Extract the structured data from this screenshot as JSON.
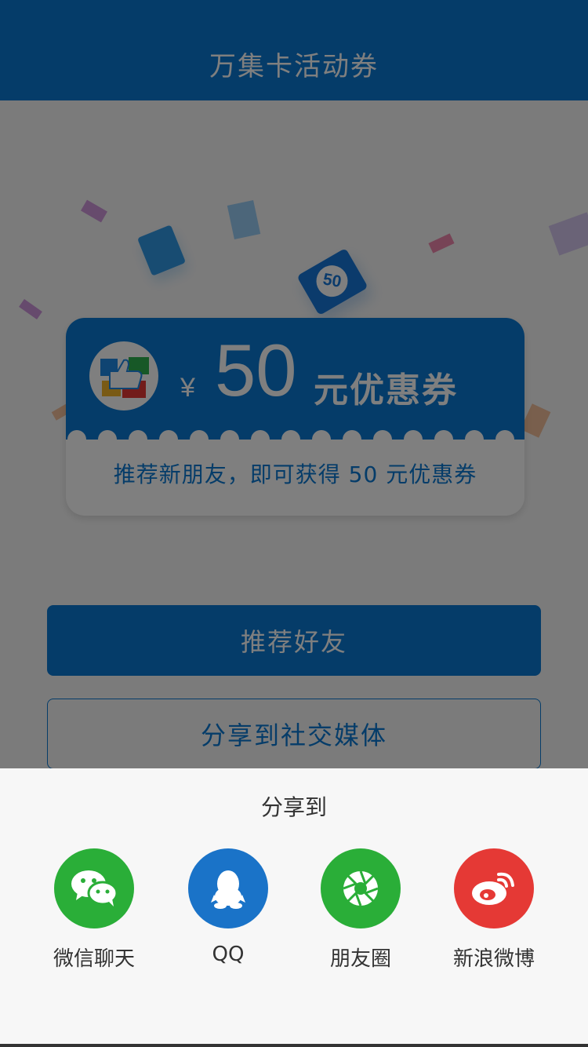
{
  "header": {
    "title": "万集卡活动券"
  },
  "coupon": {
    "badge_number": "50",
    "currency": "¥",
    "amount": "50",
    "label": "元优惠券",
    "description": "推荐新朋友，即可获得 50 元优惠券"
  },
  "buttons": {
    "recommend": "推荐好友",
    "share_social": "分享到社交媒体"
  },
  "share_sheet": {
    "title": "分享到",
    "options": [
      {
        "label": "微信聊天",
        "icon": "wechat-icon",
        "color": "#2aae38"
      },
      {
        "label": "QQ",
        "icon": "qq-icon",
        "color": "#1a73c8"
      },
      {
        "label": "朋友圈",
        "icon": "moments-icon",
        "color": "#2aae38"
      },
      {
        "label": "新浪微博",
        "icon": "weibo-icon",
        "color": "#e53935"
      }
    ]
  },
  "colors": {
    "primary": "#0a78d2",
    "wechat": "#2aae38",
    "qq": "#1a73c8",
    "weibo": "#e53935"
  }
}
